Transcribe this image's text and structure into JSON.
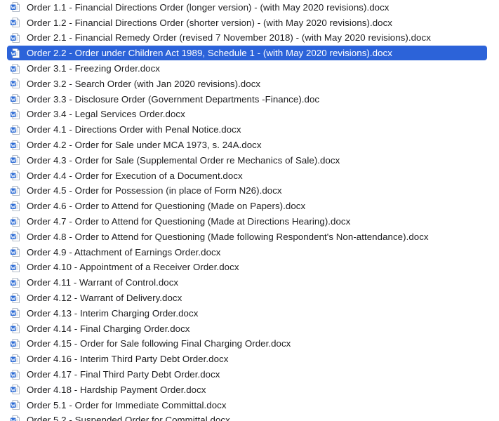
{
  "file_list": {
    "selected_index": 3,
    "items": [
      "Order 1.1 - Financial Directions Order (longer version) - (with May 2020 revisions).docx",
      "Order 1.2 - Financial Directions Order (shorter version) - (with May 2020 revisions).docx",
      "Order 2.1 - Financial Remedy Order (revised 7 November 2018) - (with May 2020 revisions).docx",
      "Order 2.2 - Order under Children Act 1989, Schedule 1 - (with May 2020 revisions).docx",
      "Order 3.1 - Freezing Order.docx",
      "Order 3.2 - Search Order (with Jan 2020 revisions).docx",
      "Order 3.3 - Disclosure Order (Government Departments -Finance).doc",
      "Order 3.4 - Legal Services Order.docx",
      "Order 4.1 - Directions Order with Penal Notice.docx",
      "Order 4.2 - Order for Sale under MCA 1973, s. 24A.docx",
      "Order 4.3 - Order for Sale (Supplemental Order re Mechanics of Sale).docx",
      "Order 4.4 - Order for Execution of a Document.docx",
      "Order 4.5 - Order for Possession (in place of Form N26).docx",
      "Order 4.6 - Order to Attend for Questioning (Made on Papers).docx",
      "Order 4.7 - Order to Attend for Questioning (Made at Directions Hearing).docx",
      "Order 4.8 - Order to Attend for Questioning (Made following Respondent's Non-attendance).docx",
      "Order 4.9 - Attachment of Earnings Order.docx",
      "Order 4.10 - Appointment of a Receiver Order.docx",
      "Order 4.11 - Warrant of Control.docx",
      "Order 4.12 - Warrant of Delivery.docx",
      "Order 4.13 - Interim Charging Order.docx",
      "Order 4.14 - Final Charging Order.docx",
      "Order 4.15 - Order for Sale following Final Charging Order.docx",
      "Order 4.16 - Interim Third Party Debt Order.docx",
      "Order 4.17 - Final Third Party Debt Order.docx",
      "Order 4.18 - Hardship Payment Order.docx",
      "Order 5.1 - Order for Immediate Committal.docx",
      "Order 5.2 - Suspended Order for Committal.docx"
    ],
    "icon": "word-document-icon",
    "colors": {
      "selection": "#2c63d9",
      "word_blue": "#2b6bd6",
      "text": "#1d1d1f"
    }
  }
}
